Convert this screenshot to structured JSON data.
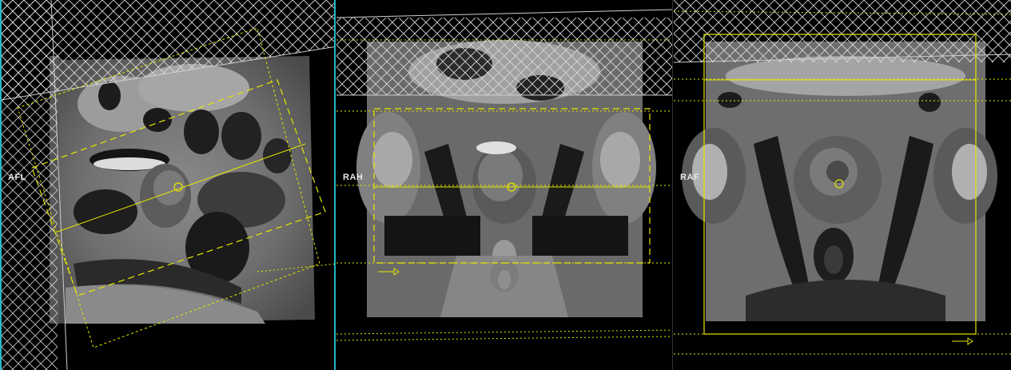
{
  "viewports": [
    {
      "id": "sagittal",
      "orientation_label": "AFL"
    },
    {
      "id": "coronal",
      "orientation_label": "RAH"
    },
    {
      "id": "axial",
      "orientation_label": "RAF"
    }
  ],
  "colors": {
    "viewport_border": "#26b8c4",
    "planning_box": "#e6e600",
    "saturation_band": "#cfcfcf",
    "background": "#000000"
  },
  "icons": [
    "center-point-icon",
    "direction-arrow-icon"
  ]
}
